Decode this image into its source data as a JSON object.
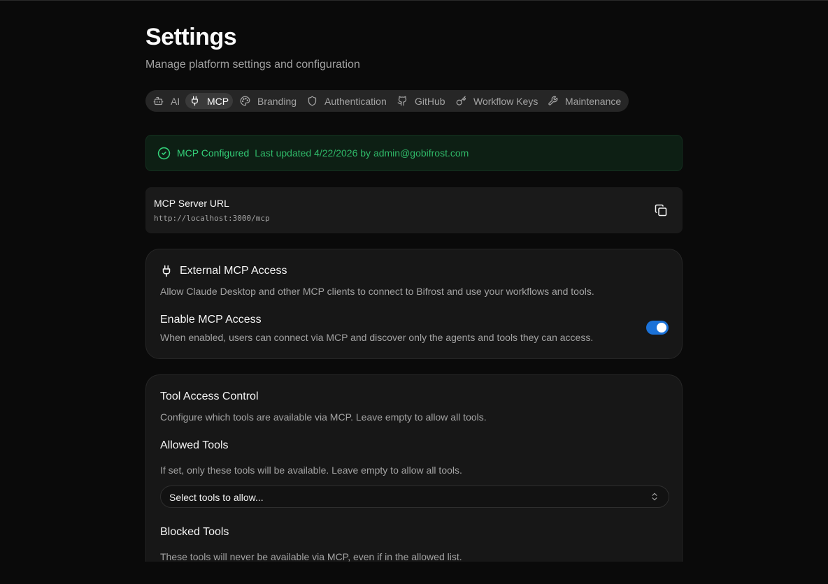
{
  "header": {
    "title": "Settings",
    "subtitle": "Manage platform settings and configuration"
  },
  "tabs": [
    {
      "label": "AI",
      "icon": "bot-icon",
      "active": false
    },
    {
      "label": "MCP",
      "icon": "plug-icon",
      "active": true
    },
    {
      "label": "Branding",
      "icon": "palette-icon",
      "active": false
    },
    {
      "label": "Authentication",
      "icon": "shield-icon",
      "active": false
    },
    {
      "label": "GitHub",
      "icon": "github-icon",
      "active": false
    },
    {
      "label": "Workflow Keys",
      "icon": "key-icon",
      "active": false
    },
    {
      "label": "Maintenance",
      "icon": "wrench-icon",
      "active": false
    }
  ],
  "status": {
    "title": "MCP Configured",
    "meta": "Last updated 4/22/2026 by admin@gobifrost.com",
    "icon": "check-circle-icon",
    "color": "#34d27a"
  },
  "server_url": {
    "label": "MCP Server URL",
    "value": "http://localhost:3000/mcp",
    "copy_icon": "copy-icon"
  },
  "external_access": {
    "title": "External MCP Access",
    "description": "Allow Claude Desktop and other MCP clients to connect to Bifrost and use your workflows and tools.",
    "enable_label": "Enable MCP Access",
    "enable_description": "When enabled, users can connect via MCP and discover only the agents and tools they can access.",
    "enabled": true,
    "accent": "#1b72d8"
  },
  "tool_access": {
    "title": "Tool Access Control",
    "description": "Configure which tools are available via MCP. Leave empty to allow all tools.",
    "allowed_title": "Allowed Tools",
    "allowed_description": "If set, only these tools will be available. Leave empty to allow all tools.",
    "allowed_placeholder": "Select tools to allow...",
    "blocked_title": "Blocked Tools",
    "blocked_description": "These tools will never be available via MCP, even if in the allowed list."
  }
}
